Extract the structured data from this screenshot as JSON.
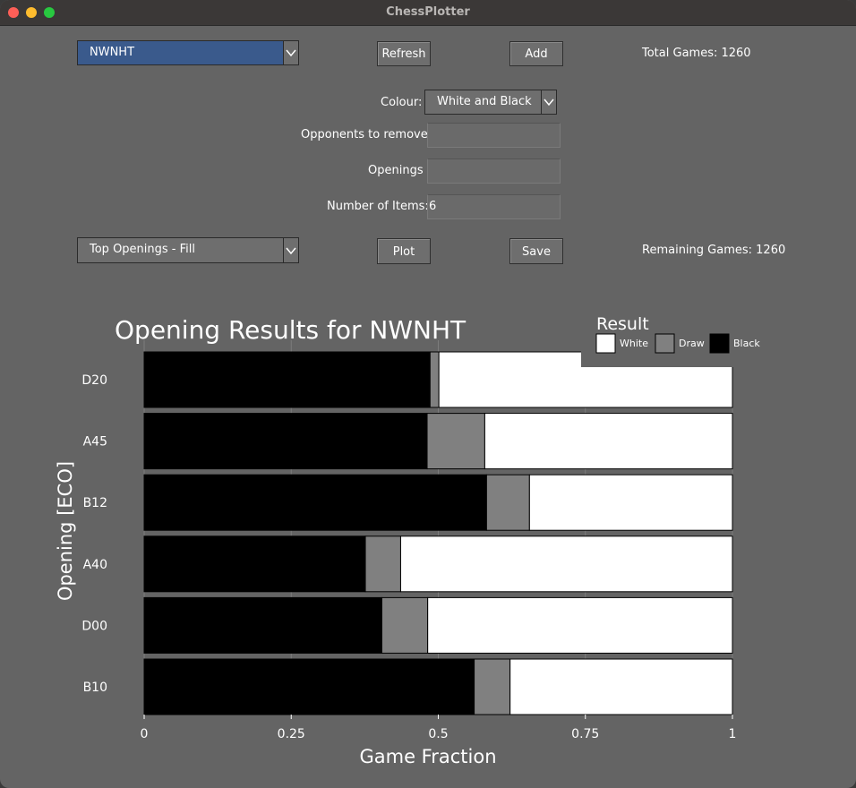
{
  "window": {
    "title": "ChessPlotter"
  },
  "controls": {
    "player_select": "NWNHT",
    "refresh_label": "Refresh",
    "add_label": "Add",
    "total_games": "Total Games: 1260",
    "colour_label": "Colour:",
    "colour_value": "White and Black",
    "opponents_label": "Opponents to remove:",
    "opponents_value": "",
    "openings_label": "Openings",
    "openings_value": "",
    "num_items_label": "Number of Items:",
    "num_items_value": "6",
    "plot_type": "Top Openings - Fill",
    "plot_label": "Plot",
    "save_label": "Save",
    "remaining_games": "Remaining Games: 1260"
  },
  "chart_data": {
    "type": "bar",
    "orientation": "horizontal",
    "stacked": true,
    "title": "Opening Results for NWNHT",
    "xlabel": "Game Fraction",
    "ylabel": "Opening [ECO]",
    "xlim": [
      0,
      1
    ],
    "xticks": [
      "0",
      "0.25",
      "0.5",
      "0.75",
      "1"
    ],
    "grid": true,
    "legend_title": "Result",
    "legend_position": "top-right",
    "categories": [
      "D20",
      "A45",
      "B12",
      "A40",
      "D00",
      "B10"
    ],
    "series": [
      {
        "name": "Black",
        "color": "#000000",
        "values": [
          0.486,
          0.481,
          0.582,
          0.376,
          0.404,
          0.561
        ]
      },
      {
        "name": "Draw",
        "color": "#808080",
        "values": [
          0.015,
          0.098,
          0.073,
          0.06,
          0.078,
          0.061
        ]
      },
      {
        "name": "White",
        "color": "#ffffff",
        "values": [
          0.499,
          0.421,
          0.345,
          0.564,
          0.518,
          0.378
        ]
      }
    ],
    "legend_order": [
      "White",
      "Draw",
      "Black"
    ]
  }
}
